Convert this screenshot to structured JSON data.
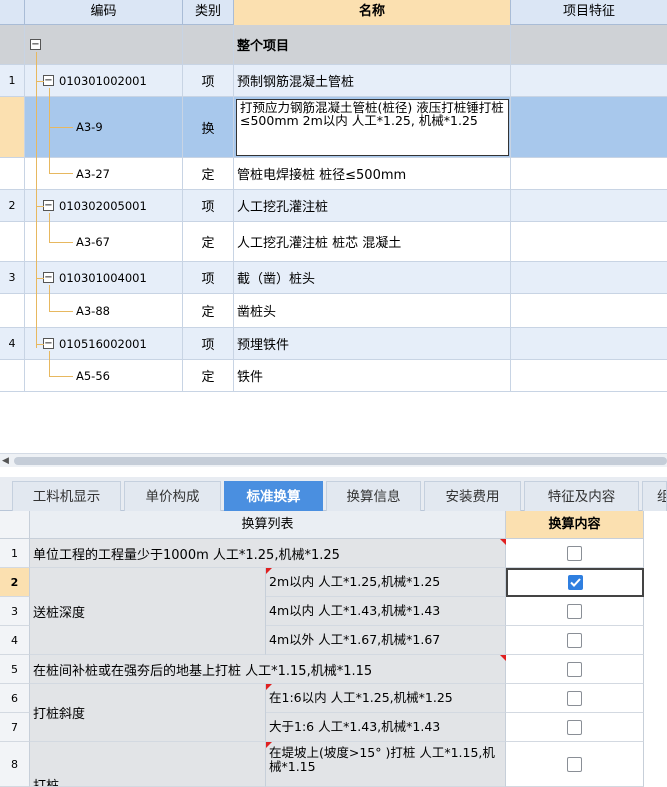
{
  "top_grid": {
    "headers": {
      "code": "编码",
      "type": "类别",
      "name": "名称",
      "feature": "项目特征"
    },
    "rows": [
      {
        "idx": "",
        "code": "",
        "type": "",
        "name": "整个项目"
      },
      {
        "idx": "1",
        "code": "010301002001",
        "type": "项",
        "name": "预制钢筋混凝土管桩"
      },
      {
        "idx": "",
        "code": "A3-9",
        "type": "换",
        "name": "打预应力钢筋混凝土管桩(桩径) 液压打桩锤打桩 ≤500mm  2m以内 人工*1.25, 机械*1.25"
      },
      {
        "idx": "",
        "code": "A3-27",
        "type": "定",
        "name": "管桩电焊接桩 桩径≤500mm"
      },
      {
        "idx": "2",
        "code": "010302005001",
        "type": "项",
        "name": "人工挖孔灌注桩"
      },
      {
        "idx": "",
        "code": "A3-67",
        "type": "定",
        "name": "人工挖孔灌注桩 桩芯 混凝土"
      },
      {
        "idx": "3",
        "code": "010301004001",
        "type": "项",
        "name": "截（凿）桩头"
      },
      {
        "idx": "",
        "code": "A3-88",
        "type": "定",
        "name": "凿桩头"
      },
      {
        "idx": "4",
        "code": "010516002001",
        "type": "项",
        "name": "预埋铁件"
      },
      {
        "idx": "",
        "code": "A5-56",
        "type": "定",
        "name": "铁件"
      }
    ]
  },
  "tabs": [
    {
      "label": "工料机显示",
      "active": false
    },
    {
      "label": "单价构成",
      "active": false
    },
    {
      "label": "标准换算",
      "active": true
    },
    {
      "label": "换算信息",
      "active": false
    },
    {
      "label": "安装费用",
      "active": false
    },
    {
      "label": "特征及内容",
      "active": false
    },
    {
      "label": "组",
      "active": false
    }
  ],
  "bottom_grid": {
    "headers": {
      "list": "换算列表",
      "content": "换算内容"
    },
    "rows": [
      {
        "idx": "1",
        "list": "单位工程的工程量少于1000m 人工*1.25,机械*1.25",
        "sub": "",
        "checked": false
      },
      {
        "idx": "2",
        "list": "送桩深度",
        "sub": "2m以内 人工*1.25,机械*1.25",
        "checked": true
      },
      {
        "idx": "3",
        "list": "",
        "sub": "4m以内 人工*1.43,机械*1.43",
        "checked": false
      },
      {
        "idx": "4",
        "list": "",
        "sub": "4m以外 人工*1.67,机械*1.67",
        "checked": false
      },
      {
        "idx": "5",
        "list": "在桩间补桩或在强夯后的地基上打桩 人工*1.15,机械*1.15",
        "sub": "",
        "checked": false
      },
      {
        "idx": "6",
        "list": "打桩斜度",
        "sub": "在1:6以内 人工*1.25,机械*1.25",
        "checked": false
      },
      {
        "idx": "7",
        "list": "",
        "sub": "大于1:6 人工*1.43,机械*1.43",
        "checked": false
      },
      {
        "idx": "8",
        "list": "",
        "sub": "在堤坡上(坡度>15° )打桩 人工*1.15,机械*1.15",
        "checked": false
      },
      {
        "idx": "",
        "list": "打桩",
        "sub": "",
        "checked": false
      }
    ]
  },
  "colors": {
    "active_tab": "#4a8fe0",
    "selected_row": "#a8c8ec",
    "header_selected": "#fbe0b0",
    "checkbox_on": "#2f7fe0"
  }
}
